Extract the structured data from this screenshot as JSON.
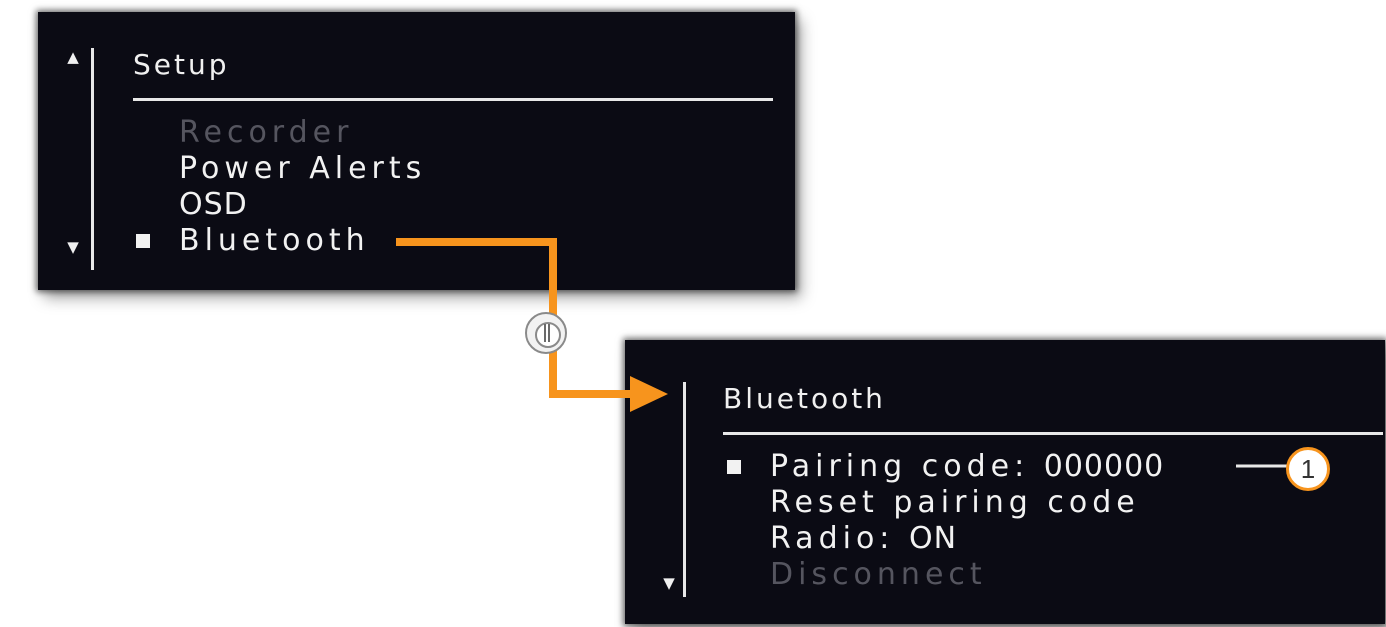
{
  "setup_screen": {
    "title": "Setup",
    "items": [
      {
        "label": "Recorder",
        "state": "disabled"
      },
      {
        "label": "Power Alerts",
        "state": "enabled"
      },
      {
        "label": "OSD",
        "state": "enabled"
      },
      {
        "label": "Bluetooth",
        "state": "selected"
      }
    ]
  },
  "bluetooth_screen": {
    "title": "Bluetooth",
    "items": [
      {
        "label": "Pairing code:",
        "value": "000000",
        "state": "selected"
      },
      {
        "label": "Reset pairing code",
        "state": "enabled"
      },
      {
        "label": "Radio:",
        "value": "ON",
        "state": "enabled"
      },
      {
        "label": "Disconnect",
        "state": "disabled"
      }
    ]
  },
  "callout": {
    "number": "1"
  },
  "icons": {
    "scroll_up": "scroll-up-arrow-icon",
    "scroll_down": "scroll-down-arrow-icon",
    "select_button": "rotary-button-icon"
  },
  "colors": {
    "screen_bg": "#0b0b14",
    "text": "#f2f2f2",
    "disabled_text": "#55555f",
    "connector": "#f7941d"
  }
}
